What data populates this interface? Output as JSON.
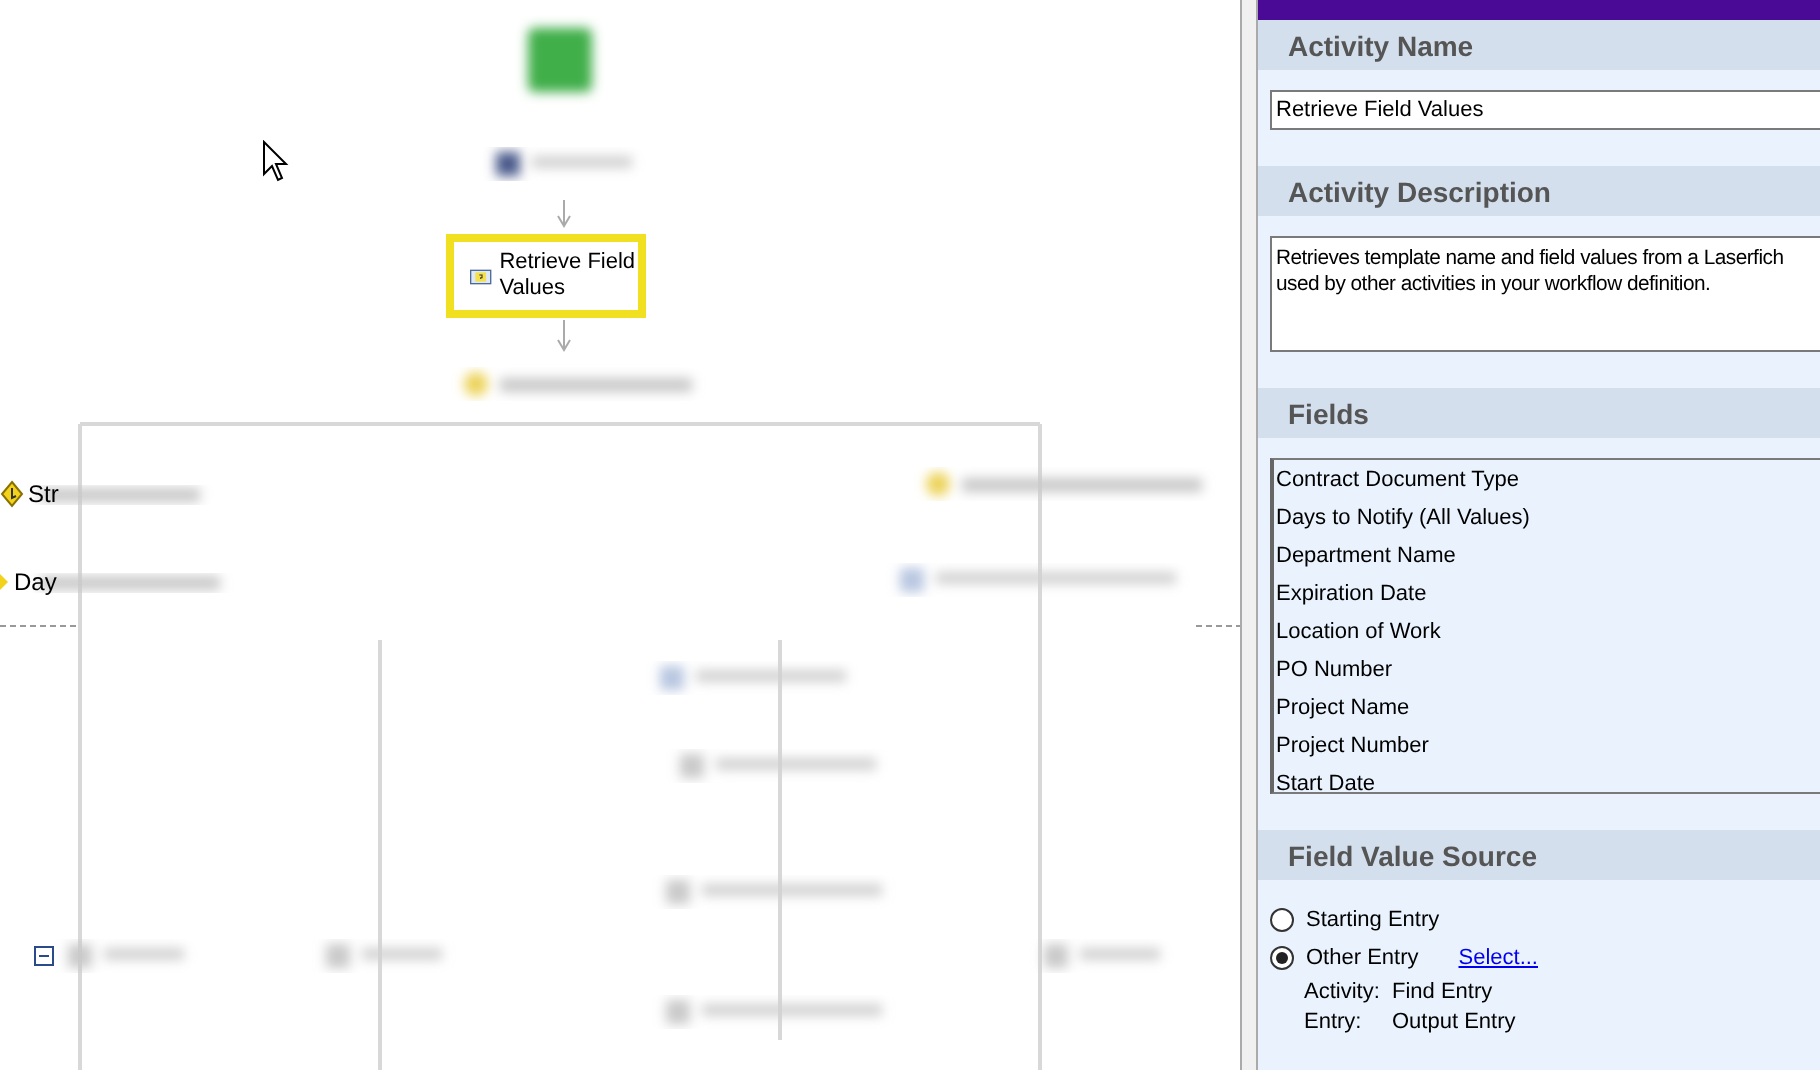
{
  "canvas": {
    "selected_activity": {
      "label": "Retrieve Field Values",
      "selected": true
    },
    "cut_labels": [
      {
        "label": "Str",
        "kind": "branch"
      },
      {
        "label": "Day",
        "kind": "condition"
      }
    ]
  },
  "panel": {
    "sections": [
      {
        "title": "Activity Name",
        "kind": "text",
        "value": "Retrieve Field Values"
      },
      {
        "title": "Activity Description",
        "kind": "textarea",
        "lines": [
          "Retrieves template name and field values from a Laserfich",
          "used by other activities in your workflow definition."
        ]
      },
      {
        "title": "Fields",
        "kind": "list",
        "items": [
          "Contract Document Type",
          "Days to Notify (All Values)",
          "Department Name",
          "Expiration Date",
          "Location of Work",
          "PO Number",
          "Project Name",
          "Project Number",
          "Start Date"
        ]
      },
      {
        "title": "Field Value Source",
        "kind": "source",
        "options": [
          {
            "label": "Starting Entry",
            "selected": false
          },
          {
            "label": "Other Entry",
            "selected": true,
            "link": "Select..."
          }
        ],
        "details": [
          {
            "label": "Activity:",
            "value": "Find Entry"
          },
          {
            "label": "Entry:",
            "value": "Output Entry"
          }
        ]
      }
    ]
  }
}
